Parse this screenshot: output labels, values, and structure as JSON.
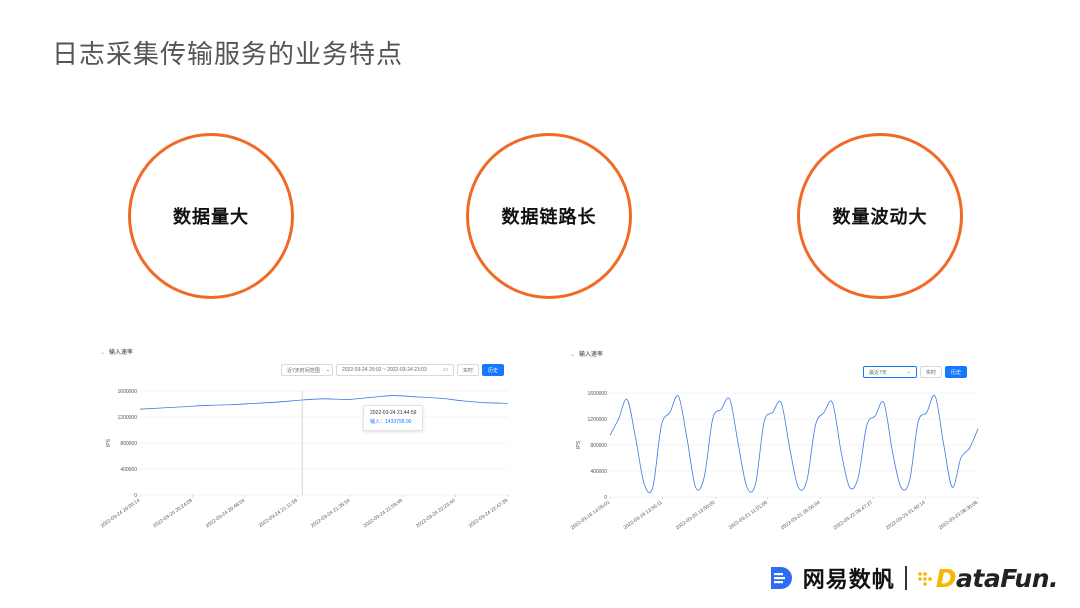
{
  "slide": {
    "title": "日志采集传输服务的业务特点"
  },
  "features": [
    {
      "label": "数据量大"
    },
    {
      "label": "数据链路长"
    },
    {
      "label": "数量波动大"
    }
  ],
  "colors": {
    "accent": "#f06a25",
    "series": "#3b78e7",
    "primary_button": "#1677ff",
    "brand_yellow": "#f5b800"
  },
  "panels": [
    {
      "header": "输入速率",
      "controls": {
        "dropdown": "近7天时间范围",
        "range_start": "2022-03-24 20:02",
        "range_sep": "~",
        "range_end": "2022-03-24 23:03",
        "btn_realtime": "实时",
        "btn_history": "历史"
      },
      "tooltip": {
        "time": "2022-03-24 21:44:59",
        "label": "输入：",
        "value": "1433798.00"
      },
      "ylabel": "IPS"
    },
    {
      "header": "输入速率",
      "controls": {
        "dropdown": "最近7天",
        "btn_realtime": "实时",
        "btn_history": "历史"
      },
      "ylabel": "IPS"
    }
  ],
  "chart_data": [
    {
      "type": "line",
      "title": "输入速率",
      "ylabel": "IPS",
      "ylim": [
        0,
        1600000
      ],
      "yticks": [
        "0",
        "400000",
        "800000",
        "1200000",
        "1600000"
      ],
      "x": [
        "2022-03-24 20:00:14",
        "2022-03-24 20:24:09",
        "2022-03-24 20:48:04",
        "2022-03-24 21:11:59",
        "2022-03-24 21:35:54",
        "2022-03-24 21:59:49",
        "2022-03-24 22:23:44",
        "2022-03-24 22:47:39"
      ],
      "series": [
        {
          "values": [
            1320000,
            1340000,
            1360000,
            1380000,
            1390000,
            1410000,
            1430000,
            1460000,
            1480000,
            1470000,
            1500000,
            1530000,
            1510000,
            1490000,
            1450000,
            1420000,
            1410000
          ]
        }
      ],
      "grid": true,
      "cursor_x": "2022-03-24 21:44:59"
    },
    {
      "type": "line",
      "title": "输入速率",
      "ylabel": "IPS",
      "ylim": [
        0,
        1600000
      ],
      "yticks": [
        "0",
        "400000",
        "800000",
        "1200000",
        "1600000"
      ],
      "x": [
        "2022-03-18 14:05:02",
        "2022-03-19 13:56:11",
        "2022-03-20 13:50:00",
        "2022-03-21 11:01:00",
        "2022-03-21 05:04:04",
        "2022-03-22 08:47:27",
        "2022-03-23 01:40:14",
        "2022-03-23 08:30:06"
      ],
      "series": [
        {
          "values": [
            950000,
            1200000,
            1500000,
            900000,
            200000,
            150000,
            1100000,
            1300000,
            1550000,
            900000,
            150000,
            300000,
            1200000,
            1350000,
            1500000,
            800000,
            150000,
            200000,
            1150000,
            1300000,
            1450000,
            750000,
            150000,
            250000,
            1100000,
            1300000,
            1450000,
            700000,
            150000,
            300000,
            1100000,
            1250000,
            1450000,
            700000,
            150000,
            250000,
            1150000,
            1300000,
            1550000,
            800000,
            150000,
            600000,
            750000,
            1050000
          ]
        }
      ],
      "grid": true
    }
  ],
  "logos": {
    "netease": "网易数帆",
    "datafun_suffix": "ataFun."
  }
}
